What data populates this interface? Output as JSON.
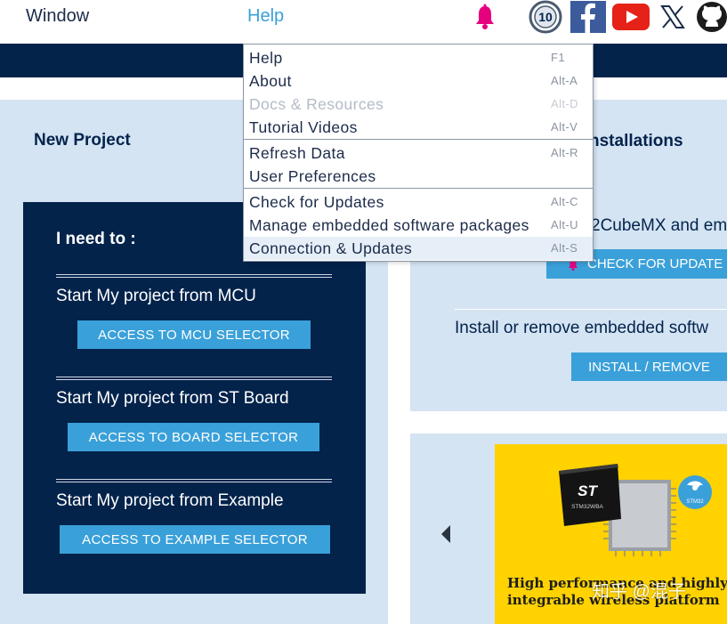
{
  "menubar": {
    "window_label": "Window",
    "help_label": "Help",
    "icons": [
      "bell-icon",
      "10-years-badge-icon",
      "facebook-icon",
      "youtube-icon",
      "x-icon",
      "github-icon"
    ],
    "badge_text": "10"
  },
  "help_menu": {
    "items": [
      {
        "label": "Help",
        "shortcut": "F1",
        "enabled": true
      },
      {
        "label": "About",
        "shortcut": "Alt-A",
        "enabled": true
      },
      {
        "label": "Docs & Resources",
        "shortcut": "Alt-D",
        "enabled": false
      },
      {
        "label": "Tutorial Videos",
        "shortcut": "Alt-V",
        "enabled": true
      },
      {
        "label": "Refresh Data",
        "shortcut": "Alt-R",
        "enabled": true
      },
      {
        "label": "User Preferences",
        "shortcut": "",
        "enabled": true
      },
      {
        "label": "Check for Updates",
        "shortcut": "Alt-C",
        "enabled": true
      },
      {
        "label": "Manage embedded software packages",
        "shortcut": "Alt-U",
        "enabled": true
      },
      {
        "label": "Connection & Updates",
        "shortcut": "Alt-S",
        "enabled": true,
        "highlighted": true
      }
    ]
  },
  "new_project": {
    "title": "New Project",
    "need_title": "I need to :",
    "sections": [
      {
        "label": "Start My project from MCU",
        "button": "ACCESS TO MCU SELECTOR"
      },
      {
        "label": "Start My project from ST Board",
        "button": "ACCESS TO BOARD SELECTOR"
      },
      {
        "label": "Start My project from Example",
        "button": "ACCESS TO EXAMPLE SELECTOR"
      }
    ]
  },
  "installations": {
    "title": "nstallations",
    "cube_text": "2CubeMX and em",
    "check_button": "CHECK FOR UPDATE",
    "install_text": "Install or remove embedded softw",
    "install_button": "INSTALL / REMOVE"
  },
  "promo": {
    "chip_brand": "ST",
    "chip_model": "STM32WBA",
    "tag": "STM32",
    "line1": "High performance and highly",
    "line2": "integrable wireless platform",
    "watermark": "知乎 @混子"
  },
  "colors": {
    "navy": "#03234b",
    "accent_blue": "#3aa0d9",
    "light_panel": "#d4e4f3",
    "promo_yellow": "#ffd200",
    "bell_pink": "#e6007e"
  }
}
